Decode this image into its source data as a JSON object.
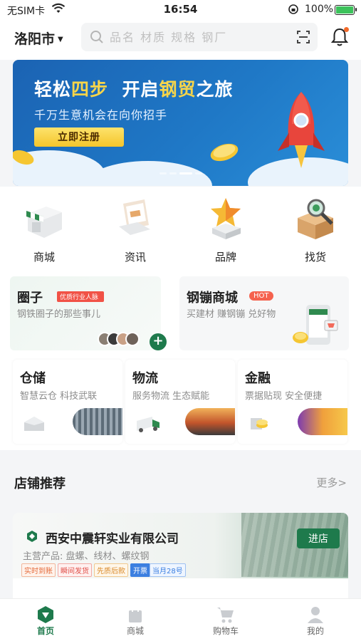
{
  "status": {
    "carrier": "无SIM卡",
    "time": "16:54",
    "battery": "100%"
  },
  "header": {
    "city": "洛阳市",
    "search_placeholder": "品名 材质 规格 钢厂"
  },
  "banner": {
    "title_a": "轻松",
    "title_hl1": "四步",
    "title_b": "  开启",
    "title_hl2": "钢贸",
    "title_c": "之旅",
    "subtitle": "千万生意机会在向你招手",
    "button": "立即注册"
  },
  "quick": [
    {
      "label": "商城",
      "icon": "shop-icon"
    },
    {
      "label": "资讯",
      "icon": "news-icon"
    },
    {
      "label": "品牌",
      "icon": "star-trophy-icon"
    },
    {
      "label": "找货",
      "icon": "box-magnifier-icon"
    }
  ],
  "circle": {
    "title": "圈子",
    "badge": "优质行业人脉",
    "subtitle": "钢铁圈子的那些事儿",
    "plus": "+"
  },
  "steel_mall": {
    "title": "钢镚商城",
    "badge": "HOT",
    "subtitle": "买建材 赚钢镚 兑好物"
  },
  "services": [
    {
      "title": "仓储",
      "subtitle": "智慧云仓 科技武联"
    },
    {
      "title": "物流",
      "subtitle": "服务物流 生态赋能"
    },
    {
      "title": "金融",
      "subtitle": "票据贴现 安全便捷"
    }
  ],
  "shops_section": {
    "title": "店铺推荐",
    "more": "更多>"
  },
  "shop": {
    "name": "西安中震轩实业有限公司",
    "main_products": "主营产品:  盘螺、线材、螺纹钢",
    "enter": "进店",
    "tags": [
      "实时到账",
      "瞬间发货",
      "先质后款",
      "开票",
      "当月28号"
    ]
  },
  "tabs": [
    {
      "label": "首页",
      "active": true
    },
    {
      "label": "商城"
    },
    {
      "label": "购物车"
    },
    {
      "label": "我的"
    }
  ],
  "colors": {
    "brand": "#1e7a4c",
    "banner": "#1f78c6",
    "accent_red": "#f15246"
  }
}
